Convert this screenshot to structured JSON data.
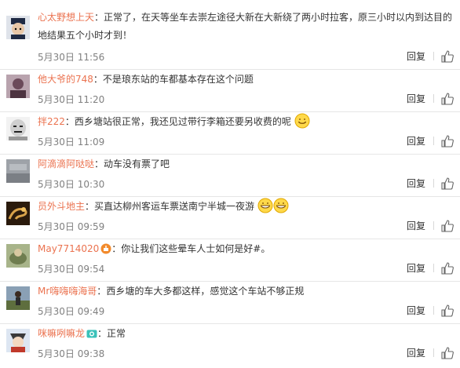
{
  "comments": [
    {
      "user": "心太野想上天",
      "sep": "：",
      "text": "正常了，在天等坐车去崇左途径大新在大新绕了两小时拉客，原三小时以内到达目的地结果五个小时才到！",
      "time": "5月30日 11:56",
      "reply": "回复",
      "avatar": "avatar-dark-hat",
      "color": "#1f2a44"
    },
    {
      "user": "他大爷的748",
      "sep": "：",
      "text": "不是琅东站的车都基本存在这个问题",
      "time": "5月30日 11:20",
      "reply": "回复",
      "avatar": "avatar-photo-purple",
      "color": "#6b4a5a"
    },
    {
      "user": "拌222",
      "sep": "：",
      "text": "西乡塘站很正常，我还见过带行李箱还要另收费的呢",
      "time": "5月30日 11:09",
      "reply": "回复",
      "avatar": "avatar-meme-face",
      "color": "#9a9a9a",
      "emoji": "smile-emoji"
    },
    {
      "user": "阿滴滴阿哒哒",
      "sep": "：",
      "text": "动车没有票了吧",
      "time": "5月30日 10:30",
      "reply": "回复",
      "avatar": "avatar-gray-photo",
      "color": "#7b7f85"
    },
    {
      "user": "员外斗地主",
      "sep": "：",
      "text": "买直达柳州客运车票送南宁半城一夜游",
      "time": "5月30日 09:59",
      "reply": "回复",
      "avatar": "avatar-gold-dragon",
      "color": "#7a4f1e",
      "emoji": "grin-emoji-double"
    },
    {
      "user": "May7714020",
      "sep": "：",
      "text": "你让我们这些晕车人士如何是好#。",
      "time": "5月30日 09:54",
      "reply": "回复",
      "avatar": "avatar-green-photo",
      "color": "#6f7d4f",
      "badge": "orange-badge-icon"
    },
    {
      "user": "Mr嗨嗨嗨海哥",
      "sep": "：",
      "text": "西乡塘的车大多都这样，感觉这个车站不够正规",
      "time": "5月30日 09:49",
      "reply": "回复",
      "avatar": "avatar-outdoor-person",
      "color": "#5e6e3e"
    },
    {
      "user": "咪嘛咧嘛龙",
      "sep": "：",
      "text": "正常",
      "time": "5月30日 09:38",
      "reply": "回复",
      "avatar": "avatar-anime",
      "color": "#c0392b",
      "badge": "camera-badge-icon"
    }
  ]
}
